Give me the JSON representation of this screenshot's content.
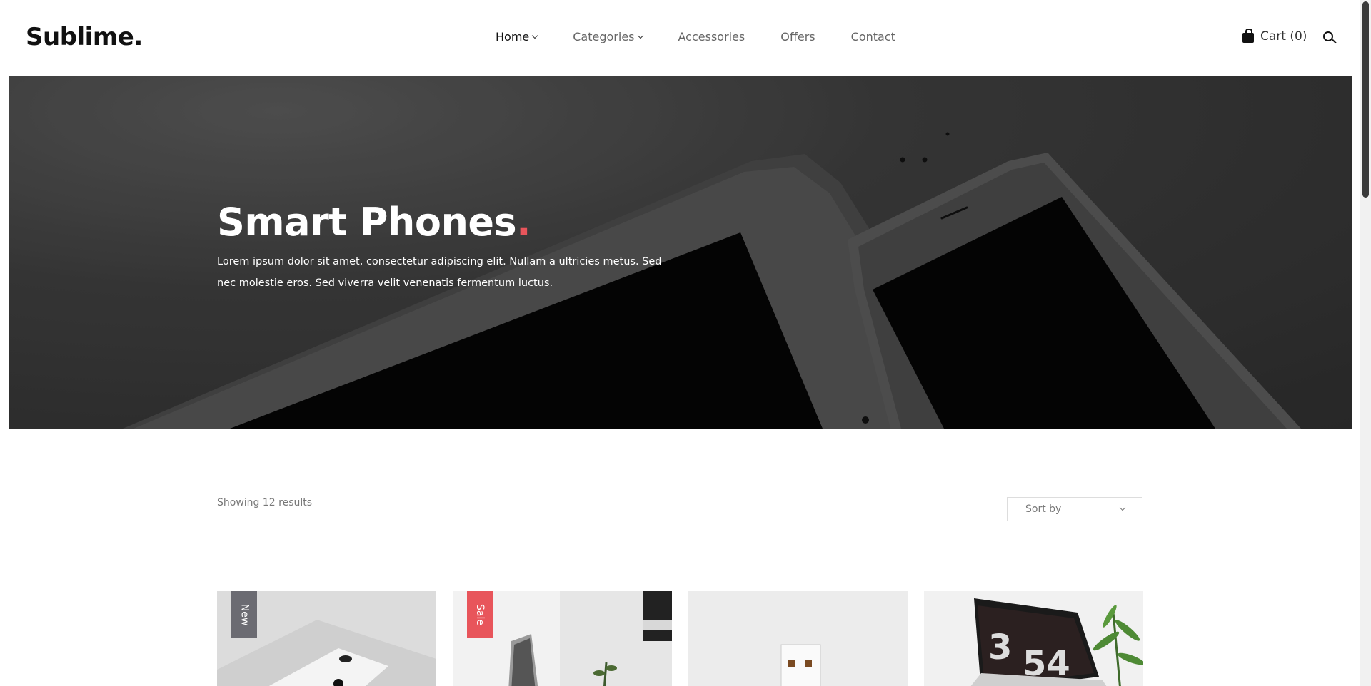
{
  "brand": {
    "logo": "Sublime."
  },
  "nav": {
    "items": [
      {
        "label": "Home",
        "has_dropdown": true,
        "active": true
      },
      {
        "label": "Categories",
        "has_dropdown": true,
        "active": false
      },
      {
        "label": "Accessories",
        "has_dropdown": false,
        "active": false
      },
      {
        "label": "Offers",
        "has_dropdown": false,
        "active": false
      },
      {
        "label": "Contact",
        "has_dropdown": false,
        "active": false
      }
    ]
  },
  "cart": {
    "label": "Cart (0)",
    "icon": "shopping-bag-icon"
  },
  "search": {
    "icon": "search-icon"
  },
  "hero": {
    "title": "Smart Phones",
    "title_dot": ".",
    "text": "Lorem ipsum dolor sit amet, consectetur adipiscing elit. Nullam a ultricies metus. Sed nec molestie eros. Sed viverra velit venenatis fermentum luctus."
  },
  "listing": {
    "results_text": "Showing 12 results",
    "sort_label": "Sort by"
  },
  "products": [
    {
      "badge": "New",
      "badge_type": "new"
    },
    {
      "badge": "Sale",
      "badge_type": "sale"
    },
    {
      "badge": "",
      "badge_type": ""
    },
    {
      "badge": "",
      "badge_type": ""
    }
  ],
  "colors": {
    "accent": "#e8555b",
    "badge_new": "#6b6b72",
    "hero_bg": "#3a3a3a"
  }
}
